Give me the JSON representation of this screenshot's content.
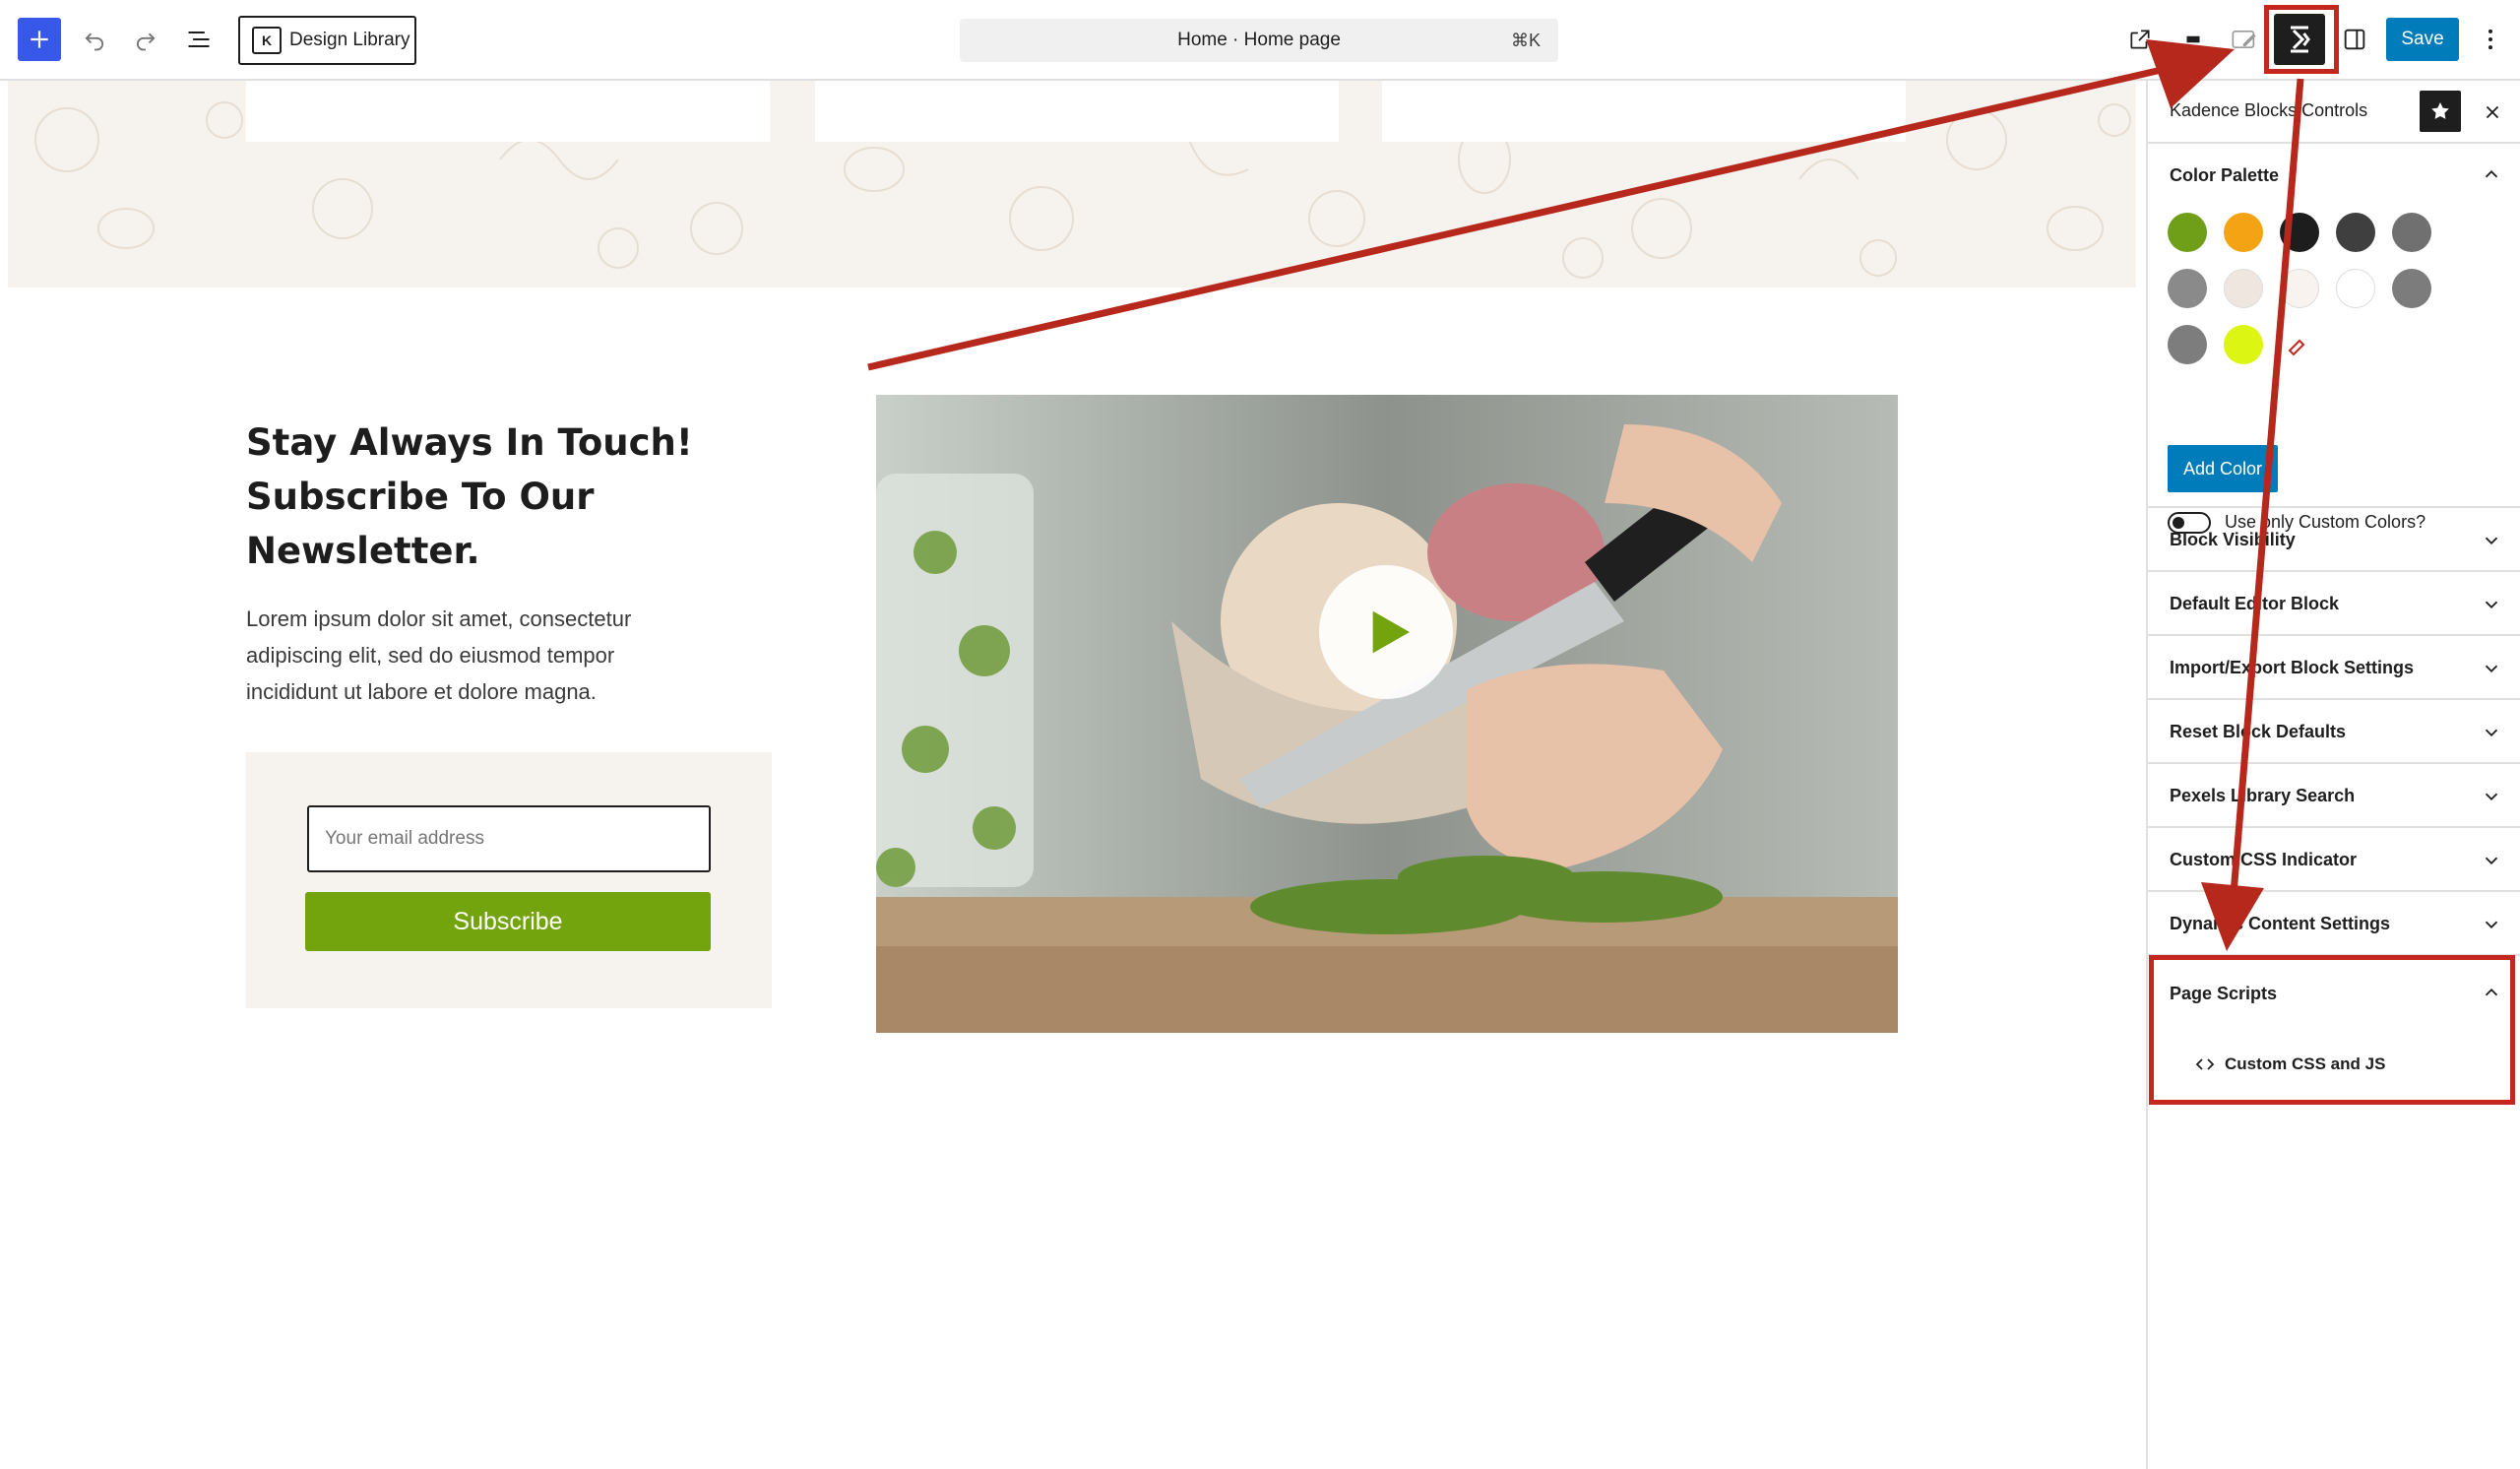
{
  "toolbar": {
    "design_library_label": "Design Library",
    "command_bar_text": "Home · Home page",
    "command_shortcut": "⌘K",
    "save_label": "Save",
    "icons": [
      "plus-icon",
      "undo-icon",
      "redo-icon",
      "list-view-icon",
      "view-external-icon",
      "pencil-icon",
      "kadence-icon",
      "sidebar-panel-icon",
      "more-vertical-icon"
    ]
  },
  "canvas": {
    "heading": "Stay Always In Touch! Subscribe To Our Newsletter.",
    "body_text": "Lorem ipsum dolor sit amet, consectetur adipiscing elit, sed do eiusmod tempor incididunt ut labore et dolore magna.",
    "email_placeholder": "Your email address",
    "subscribe_label": "Subscribe"
  },
  "sidebar": {
    "title": "Kadence Blocks Controls",
    "color_palette": {
      "title": "Color Palette",
      "swatches": [
        "#6f9f18",
        "#f3a314",
        "#1d1d1d",
        "#3f3f3f",
        "#707070",
        "#8a8a8a",
        "#efe7df",
        "#f8f3ee",
        "#ffffff",
        "#7c7c7c",
        "#7d7d7d",
        "#dcf513"
      ],
      "add_color_label": "Add Color",
      "toggle_label": "Use only Custom Colors?"
    },
    "sections": [
      {
        "label": "Block Visibility"
      },
      {
        "label": "Default Editor Block"
      },
      {
        "label": "Import/Export Block Settings"
      },
      {
        "label": "Reset Block Defaults"
      },
      {
        "label": "Pexels Library Search"
      },
      {
        "label": "Custom CSS Indicator"
      },
      {
        "label": "Dynamic Content Settings"
      }
    ],
    "page_scripts": {
      "title": "Page Scripts",
      "item_label": "Custom CSS and JS"
    }
  },
  "colors": {
    "accent_blue": "#3858e9",
    "save_blue": "#007cba",
    "subscribe_green": "#73a30d",
    "annotation_red": "#c4271d"
  }
}
